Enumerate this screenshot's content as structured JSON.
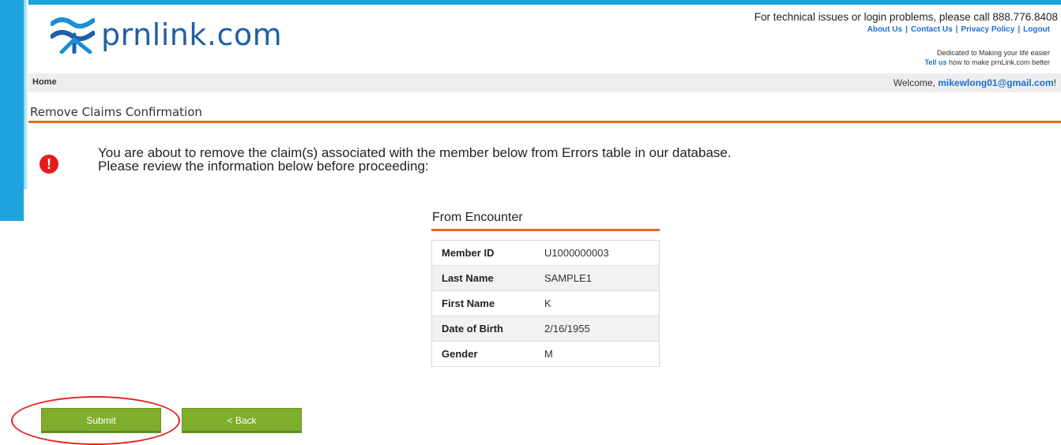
{
  "header": {
    "logo_text": "prnlink.com",
    "support_text": "For technical issues or login problems, please call 888.776.8408",
    "links": [
      "About Us",
      "Contact Us",
      "Privacy Policy",
      "Logout"
    ],
    "tagline": "Dedicated to Making your life easier",
    "tell_us_link": "Tell us",
    "tell_us_rest": "how to make prnLink.com better"
  },
  "nav": {
    "home": "Home",
    "welcome_prefix": "Welcome, ",
    "user_email": "mikewlong01@gmail.com",
    "welcome_suffix": "!"
  },
  "page": {
    "title": "Remove Claims Confirmation",
    "warning_line1": "You are about to remove the claim(s) associated with the member below from Errors table in our database.",
    "warning_line2": "Please review the information below before proceeding:"
  },
  "encounter": {
    "title": "From Encounter",
    "rows": [
      {
        "label": "Member ID",
        "value": "U1000000003"
      },
      {
        "label": "Last Name",
        "value": "SAMPLE1"
      },
      {
        "label": "First Name",
        "value": "K"
      },
      {
        "label": "Date of Birth",
        "value": "2/16/1955"
      },
      {
        "label": "Gender",
        "value": "M"
      }
    ]
  },
  "buttons": {
    "submit": "Submit",
    "back": "< Back"
  },
  "colors": {
    "accent_blue": "#1fa3dd",
    "link_blue": "#1f6fd1",
    "rule_orange": "#e86a1e",
    "button_green": "#7fae2c",
    "alert_red": "#e41c1c"
  },
  "icons": {
    "logo": "prnlink-logo-icon",
    "warning": "exclamation-icon"
  }
}
